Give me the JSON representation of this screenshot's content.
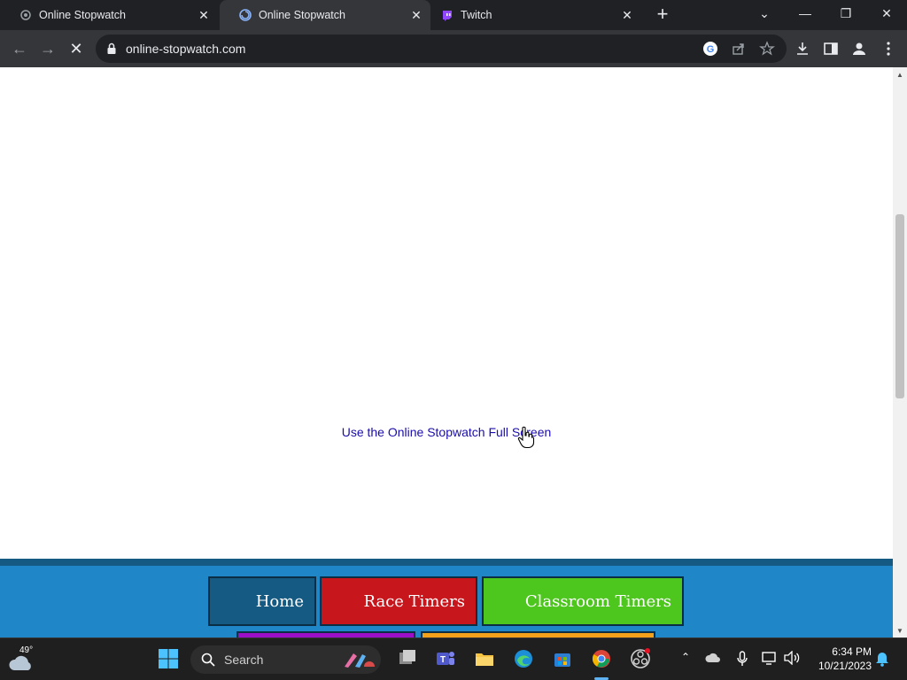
{
  "browser": {
    "tabs": [
      {
        "title": "Online Stopwatch",
        "active": false
      },
      {
        "title": "Online Stopwatch",
        "active": true
      },
      {
        "title": "Twitch",
        "active": false
      }
    ],
    "url": "online-stopwatch.com"
  },
  "page": {
    "fullscreen_link": "Use the Online Stopwatch Full Screen",
    "nav": {
      "home": "Home",
      "race_timers": "Race Timers",
      "classroom_timers": "Classroom Timers"
    },
    "colors": {
      "footer_band": "#1f87c7",
      "home": "#155a82",
      "race": "#c8161d",
      "classroom": "#4dc61e",
      "purple": "#9b0fc8",
      "orange": "#f3a11a",
      "link": "#1a0dab"
    }
  },
  "taskbar": {
    "weather_temp": "49°",
    "search_label": "Search",
    "time": "6:34 PM",
    "date": "10/21/2023"
  }
}
